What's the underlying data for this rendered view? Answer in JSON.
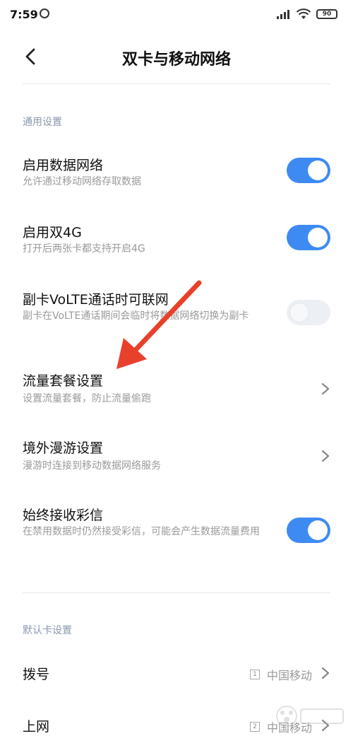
{
  "status": {
    "time": "7:59",
    "battery": "90"
  },
  "header": {
    "title": "双卡与移动网络"
  },
  "sections": {
    "general": "通用设置",
    "default_card": "默认卡设置"
  },
  "rows": {
    "data_network": {
      "title": "启用数据网络",
      "subtitle": "允许通过移动网络存取数据",
      "enabled": true
    },
    "dual_4g": {
      "title": "启用双4G",
      "subtitle": "打开后两张卡都支持开启4G",
      "enabled": true
    },
    "volte_data": {
      "title": "副卡VoLTE通话时可联网",
      "subtitle": "副卡在VoLTE通话期间会临时将数据网络切换为副卡",
      "enabled": false
    },
    "data_plan": {
      "title": "流量套餐设置",
      "subtitle": "设置流量套餐，防止流量偷跑"
    },
    "roaming": {
      "title": "境外漫游设置",
      "subtitle": "漫游时连接到移动数据网络服务"
    },
    "mms": {
      "title": "始终接收彩信",
      "subtitle": "在禁用数据时仍然接受彩信，可能会产生数据流量费用",
      "enabled": true
    },
    "dial": {
      "title": "拨号",
      "sim": "1",
      "carrier": "中国移动"
    },
    "internet": {
      "title": "上网",
      "sim": "2",
      "carrier": "中国移动"
    }
  },
  "colors": {
    "accent": "#3d8bf2",
    "annotation_arrow": "#e8412b"
  }
}
